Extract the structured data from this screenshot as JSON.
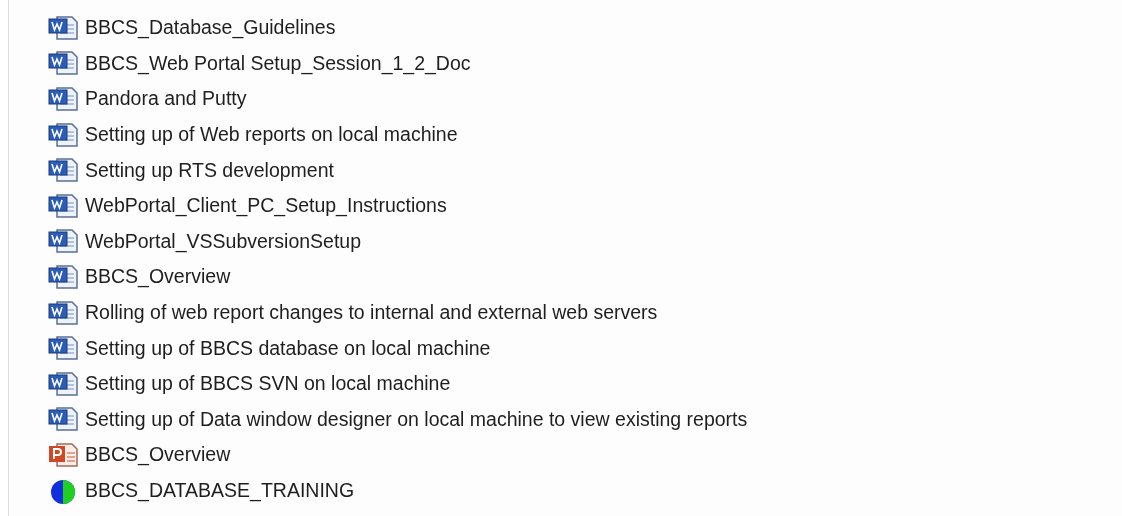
{
  "files": [
    {
      "kind": "word",
      "name": "BBCS_Database_Guidelines"
    },
    {
      "kind": "word",
      "name": "BBCS_Web Portal Setup_Session_1_2_Doc"
    },
    {
      "kind": "word",
      "name": "Pandora and Putty"
    },
    {
      "kind": "word",
      "name": "Setting up of Web reports on local machine"
    },
    {
      "kind": "word",
      "name": "Setting up RTS development"
    },
    {
      "kind": "word",
      "name": "WebPortal_Client_PC_Setup_Instructions"
    },
    {
      "kind": "word",
      "name": "WebPortal_VSSubversionSetup"
    },
    {
      "kind": "word",
      "name": "BBCS_Overview"
    },
    {
      "kind": "word",
      "name": "Rolling of web report changes to internal and external web servers"
    },
    {
      "kind": "word",
      "name": "Setting up of BBCS database on local machine"
    },
    {
      "kind": "word",
      "name": "Setting up of BBCS SVN on local machine"
    },
    {
      "kind": "word",
      "name": "Setting up of Data window designer on local machine to view existing reports"
    },
    {
      "kind": "powerpoint",
      "name": "BBCS_Overview"
    },
    {
      "kind": "pie",
      "name": "BBCS_DATABASE_TRAINING"
    }
  ]
}
